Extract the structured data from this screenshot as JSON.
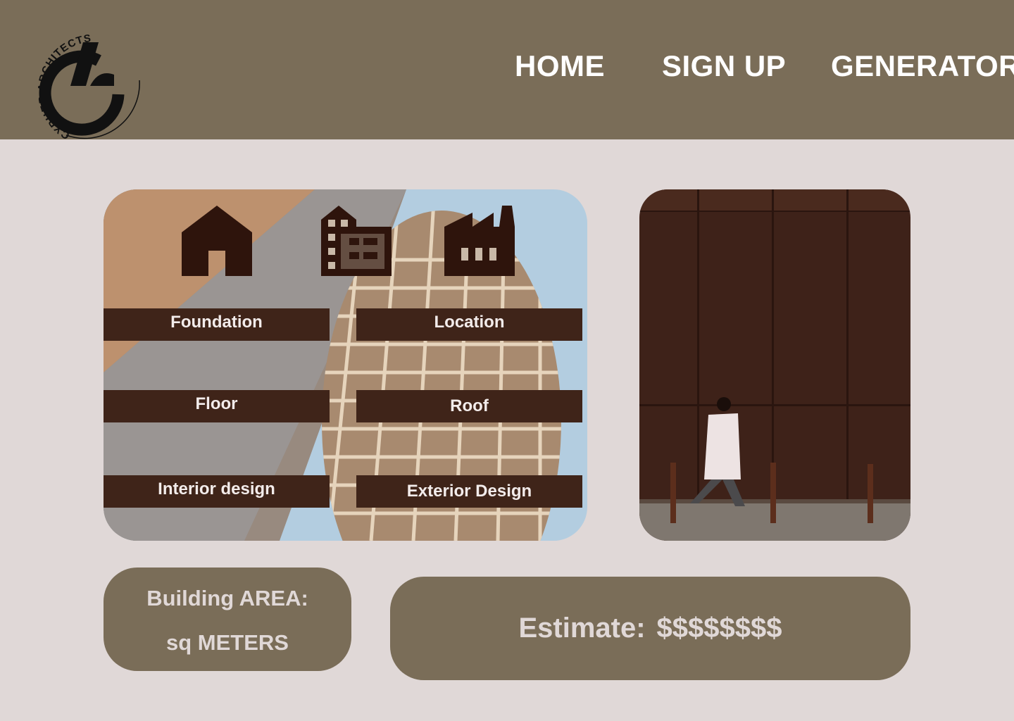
{
  "brand": {
    "logo_text": "CYPHER ARCHITECTS",
    "logo_icon": "cypher-architects-logo"
  },
  "nav": {
    "home": "HOME",
    "sign_up": "SIGN UP",
    "generator": "GENERATOR"
  },
  "building_types": [
    "house-icon",
    "apartment-building-icon",
    "factory-icon"
  ],
  "options": {
    "foundation": "Foundation",
    "location": "Location",
    "floor": "Floor",
    "roof": "Roof",
    "interior": "Interior design",
    "exterior": "Exterior Design"
  },
  "area": {
    "label": "Building AREA:",
    "unit": "sq METERS"
  },
  "estimate": {
    "label": "Estimate:",
    "value": "$$$$$$$$"
  },
  "colors": {
    "header": "#7a6d58",
    "background": "#e0d8d7",
    "button": "#3f2419",
    "icon": "#2e140c"
  }
}
